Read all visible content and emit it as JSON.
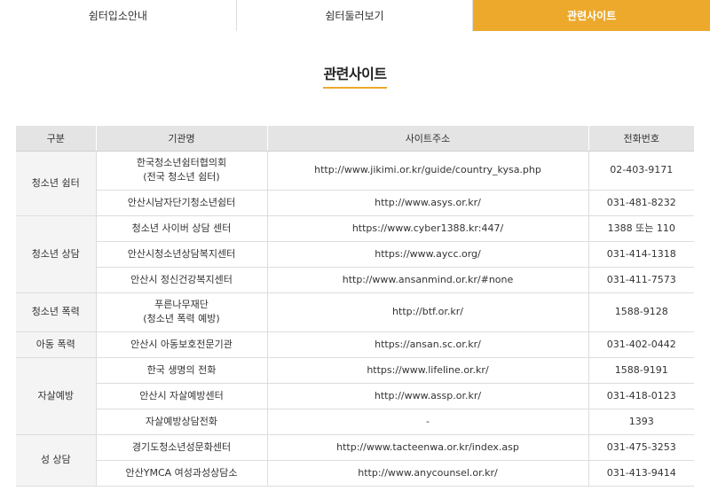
{
  "tabs": [
    {
      "label": "쉼터입소안내",
      "active": false
    },
    {
      "label": "쉼터둘러보기",
      "active": false
    },
    {
      "label": "관련사이트",
      "active": true
    }
  ],
  "page_title": "관련사이트",
  "colors": {
    "accent": "#eca92c",
    "header_bg": "#e4e4e4",
    "category_bg": "#f4f4f4"
  },
  "table": {
    "headers": [
      "구분",
      "기관명",
      "사이트주소",
      "전화번호"
    ],
    "groups": [
      {
        "category": "청소년 쉼터",
        "rows": [
          {
            "org_line1": "한국청소년쉼터협의회",
            "org_line2": "(전국 청소년 쉼터)",
            "url": "http://www.jikimi.or.kr/guide/country_kysa.php",
            "phone": "02-403-9171"
          },
          {
            "org": "안산시남자단기청소년쉼터",
            "url": "http://www.asys.or.kr/",
            "phone": "031-481-8232"
          }
        ]
      },
      {
        "category": "청소년 상담",
        "rows": [
          {
            "org": "청소년 사이버 상담 센터",
            "url": "https://www.cyber1388.kr:447/",
            "phone": "1388 또는 110"
          },
          {
            "org": "안산시청소년상담복지센터",
            "url": "https://www.aycc.org/",
            "phone": "031-414-1318"
          },
          {
            "org": "안산시 정신건강복지센터",
            "url": "http://www.ansanmind.or.kr/#none",
            "phone": "031-411-7573"
          }
        ]
      },
      {
        "category": "청소년 폭력",
        "rows": [
          {
            "org_line1": "푸른나무재단",
            "org_line2": "(청소년 폭력 예방)",
            "url": "http://btf.or.kr/",
            "phone": "1588-9128"
          }
        ]
      },
      {
        "category": "아동 폭력",
        "rows": [
          {
            "org": "안산시 아동보호전문기관",
            "url": "https://ansan.sc.or.kr/",
            "phone": "031-402-0442"
          }
        ]
      },
      {
        "category": "자살예방",
        "rows": [
          {
            "org": "한국 생명의 전화",
            "url": "https://www.lifeline.or.kr/",
            "phone": "1588-9191"
          },
          {
            "org": "안산시 자살예방센터",
            "url": "http://www.assp.or.kr/",
            "phone": "031-418-0123"
          },
          {
            "org": "자살예방상담전화",
            "url": "-",
            "phone": "1393"
          }
        ]
      },
      {
        "category": "성 상담",
        "rows": [
          {
            "org": "경기도청소년성문화센터",
            "url": "http://www.tacteenwa.or.kr/index.asp",
            "phone": "031-475-3253"
          },
          {
            "org": "안산YMCA 여성과성상담소",
            "url": "http://www.anycounsel.or.kr/",
            "phone": "031-413-9414"
          }
        ]
      }
    ]
  }
}
